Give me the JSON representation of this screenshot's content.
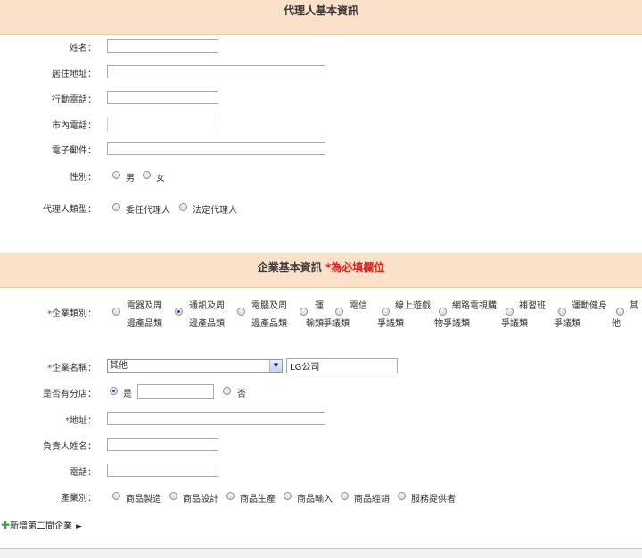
{
  "agent_section": {
    "title": "代理人基本資訊",
    "fields": {
      "name": "姓名：",
      "address": "居住地址：",
      "mobile": "行動電話：",
      "landline": "市內電話：",
      "email": "電子郵件：",
      "gender": "性別：",
      "agent_type": "代理人類型："
    },
    "gender_options": [
      "男",
      "女"
    ],
    "agent_type_options": [
      "委任代理人",
      "法定代理人"
    ]
  },
  "company_section": {
    "title": "企業基本資訊",
    "required_note": "*為必填欄位",
    "star": "*",
    "category_label": "企業類別：",
    "categories": [
      {
        "line1": "電器及周",
        "line2": "邊產品類"
      },
      {
        "line1": "通訊及周",
        "line2": "邊產品類"
      },
      {
        "line1": "電腦及周",
        "line2": "邊產品類"
      },
      {
        "line1": "運",
        "line2": "輸類"
      },
      {
        "line1": "電信",
        "line2": "爭議類"
      },
      {
        "line1": "線上遊戲",
        "line2": "爭議類"
      },
      {
        "line1": "網路電視購",
        "line2": "物爭議類"
      },
      {
        "line1": "補習班",
        "line2": "爭議類"
      },
      {
        "line1": "運動健身",
        "line2": "爭議類"
      },
      {
        "line1": "其",
        "line2": "他"
      }
    ],
    "name_label": "企業名稱：",
    "name_select_value": "其他",
    "name_input_value": "LG公司",
    "branch_label": "是否有分店：",
    "branch_options": [
      "是",
      "否"
    ],
    "address_label": "地址：",
    "person_label": "負責人姓名：",
    "phone_label": "電話：",
    "industry_label": "產業別：",
    "industry_options": [
      "商品製造",
      "商品設計",
      "商品生產",
      "商品輸入",
      "商品經銷",
      "服務提供者"
    ]
  },
  "add_company": "新增第二間企業"
}
